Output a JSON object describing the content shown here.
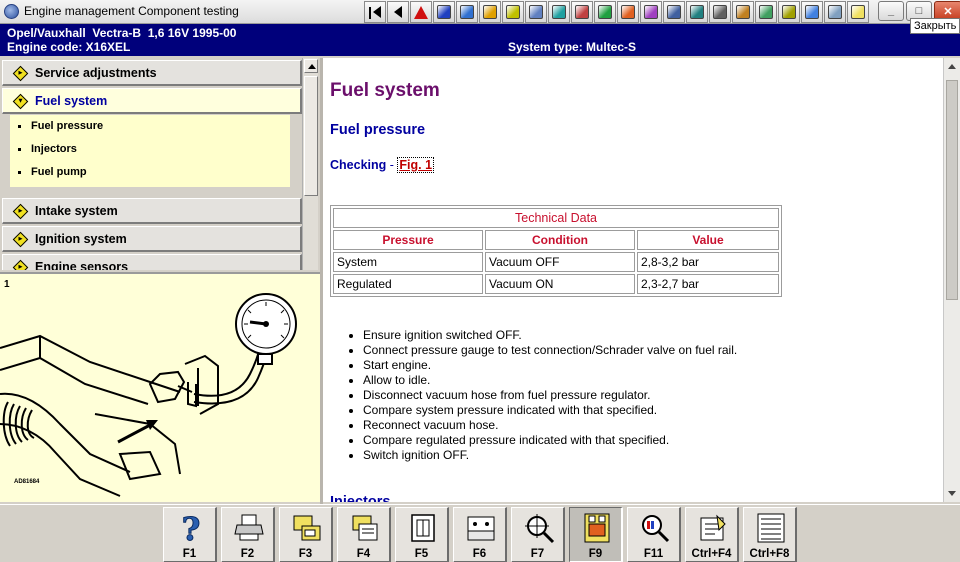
{
  "window": {
    "title": "Engine management Component testing",
    "tooltip": "Закрыть",
    "controls": {
      "minimize_glyph": "_",
      "maximize_glyph": "□",
      "close_glyph": "✕"
    }
  },
  "toolbar": {
    "icons": [
      "first-page-icon",
      "previous-page-icon",
      "warning-icon",
      "flag-icon",
      "camera-icon",
      "gear-icon",
      "wrench-icon",
      "gauge-icon",
      "tools-icon",
      "oil-can-icon",
      "battery-icon",
      "fuel-pump-icon",
      "engine-icon",
      "air-filter-icon",
      "key-icon",
      "brake-icon",
      "transmission-icon",
      "radiator-icon",
      "service-icon",
      "triangle-icon",
      "car-icon",
      "lamp-icon"
    ],
    "colors": [
      "#000000",
      "#000000",
      "#d01010",
      "#2040c0",
      "#3070d0",
      "#e0a000",
      "#c0c000",
      "#6080c0",
      "#20a0a0",
      "#c04040",
      "#20a040",
      "#e06020",
      "#a040c0",
      "#4060a0",
      "#208080",
      "#606060",
      "#c08020",
      "#40a060",
      "#a0a000",
      "#4080e0",
      "#80a0c0",
      "#f0e060"
    ]
  },
  "header": {
    "vehicle": "Opel/Vauxhall  Vectra-B  1,6 16V 1995-00",
    "engine_code": "Engine code: X16XEL",
    "system_type": "System type: Multec-S"
  },
  "nav": {
    "items": [
      {
        "label": "Service adjustments"
      },
      {
        "label": "Fuel system"
      },
      {
        "label": "Intake system"
      },
      {
        "label": "Ignition system"
      },
      {
        "label": "Engine sensors"
      }
    ],
    "sub_items": [
      "Fuel pressure",
      "Injectors",
      "Fuel pump"
    ]
  },
  "figure": {
    "number": "1",
    "code": "AD81684"
  },
  "content": {
    "page_title": "Fuel system",
    "section_heading": "Fuel pressure",
    "checking_label": "Checking",
    "checking_separator": " - ",
    "fig_link": "Fig. 1",
    "table": {
      "caption": "Technical Data",
      "columns": [
        "Pressure",
        "Condition",
        "Value"
      ],
      "rows": [
        [
          "System",
          "Vacuum OFF",
          "2,8-3,2 bar"
        ],
        [
          "Regulated",
          "Vacuum ON",
          "2,3-2,7 bar"
        ]
      ]
    },
    "steps": [
      "Ensure ignition switched OFF.",
      "Connect pressure gauge to test connection/Schrader valve on fuel rail.",
      "Start engine.",
      "Allow to idle.",
      "Disconnect vacuum hose from fuel pressure regulator.",
      "Compare system pressure indicated with that specified.",
      "Reconnect vacuum hose.",
      "Compare regulated pressure indicated with that specified.",
      "Switch ignition OFF."
    ],
    "next_heading": "Injectors"
  },
  "function_keys": [
    {
      "label": "F1",
      "icon": "help-icon"
    },
    {
      "label": "F2",
      "icon": "printer-icon"
    },
    {
      "label": "F3",
      "icon": "data-transfer-icon"
    },
    {
      "label": "F4",
      "icon": "notes-icon"
    },
    {
      "label": "F5",
      "icon": "connector-icon"
    },
    {
      "label": "F6",
      "icon": "pin-layout-icon"
    },
    {
      "label": "F7",
      "icon": "magnifier-target-icon"
    },
    {
      "label": "F9",
      "icon": "component-location-icon"
    },
    {
      "label": "F11",
      "icon": "search-abc-icon"
    },
    {
      "label": "Ctrl+F4",
      "icon": "edit-note-icon"
    },
    {
      "label": "Ctrl+F8",
      "icon": "list-icon"
    }
  ]
}
